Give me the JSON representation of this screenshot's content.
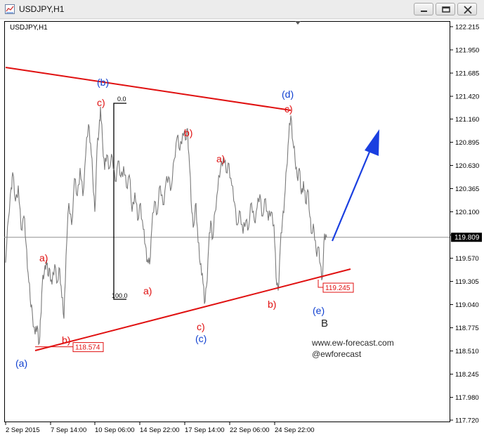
{
  "window": {
    "title": "USDJPY,H1",
    "icon": "chart-window-icon",
    "controls": [
      "minimize-icon",
      "restore-icon",
      "close-icon"
    ]
  },
  "colors": {
    "price": "#7a7a7a",
    "trendline": "#e01010",
    "wave_red": "#e01010",
    "wave_blue": "#1040d0",
    "arrow": "#1a3fe0",
    "bid_line": "#909090",
    "background": "#ffffff"
  },
  "chart_data": {
    "type": "line",
    "symbol_label": "USDJPY,H1",
    "x_ticks": [
      "2 Sep 2015",
      "7 Sep 14:00",
      "10 Sep 06:00",
      "14 Sep 22:00",
      "17 Sep 14:00",
      "22 Sep 06:00",
      "24 Sep 22:00"
    ],
    "y_ticks": [
      "122.215",
      "121.950",
      "121.685",
      "121.420",
      "121.160",
      "120.895",
      "120.630",
      "120.365",
      "120.100",
      "119.835",
      "119.570",
      "119.305",
      "119.040",
      "118.775",
      "118.510",
      "118.245",
      "117.980",
      "117.720"
    ],
    "ylim": [
      117.72,
      122.215
    ],
    "xlim": [
      0,
      660
    ],
    "current_price": "119.809",
    "price_labels": [
      "118.574",
      "119.245"
    ],
    "fib_labels": [
      "0.0",
      "100.0"
    ],
    "series": [
      {
        "values": [
          [
            0,
            119.52
          ],
          [
            4,
            120.02
          ],
          [
            8,
            120.38
          ],
          [
            10,
            120.55
          ],
          [
            14,
            120.22
          ],
          [
            18,
            120.4
          ],
          [
            22,
            119.9
          ],
          [
            26,
            120.05
          ],
          [
            29,
            119.74
          ],
          [
            32,
            119.4
          ],
          [
            35,
            119.1
          ],
          [
            38,
            118.95
          ],
          [
            42,
            118.7
          ],
          [
            45,
            118.8
          ],
          [
            48,
            118.6
          ],
          [
            50,
            118.9
          ],
          [
            52,
            119.25
          ],
          [
            55,
            119.4
          ],
          [
            58,
            119.55
          ],
          [
            60,
            119.38
          ],
          [
            63,
            119.44
          ],
          [
            66,
            119.27
          ],
          [
            70,
            119.5
          ],
          [
            74,
            119.3
          ],
          [
            77,
            119.45
          ],
          [
            80,
            119.12
          ],
          [
            83,
            118.88
          ],
          [
            86,
            119.6
          ],
          [
            90,
            120.2
          ],
          [
            94,
            119.95
          ],
          [
            98,
            120.48
          ],
          [
            102,
            120.28
          ],
          [
            106,
            120.6
          ],
          [
            110,
            120.28
          ],
          [
            114,
            120.75
          ],
          [
            118,
            121.1
          ],
          [
            121,
            120.88
          ],
          [
            124,
            120.5
          ],
          [
            127,
            120.1
          ],
          [
            130,
            120.8
          ],
          [
            133,
            121.05
          ],
          [
            135,
            121.3
          ],
          [
            138,
            120.9
          ],
          [
            141,
            120.58
          ],
          [
            144,
            120.75
          ],
          [
            148,
            120.6
          ],
          [
            152,
            120.72
          ],
          [
            156,
            120.45
          ],
          [
            160,
            120.68
          ],
          [
            164,
            120.5
          ],
          [
            168,
            120.62
          ],
          [
            172,
            120.38
          ],
          [
            176,
            120.52
          ],
          [
            180,
            120.1
          ],
          [
            184,
            120.32
          ],
          [
            188,
            120.0
          ],
          [
            192,
            120.2
          ],
          [
            196,
            119.9
          ],
          [
            199,
            119.72
          ],
          [
            202,
            119.55
          ],
          [
            205,
            119.5
          ],
          [
            208,
            119.9
          ],
          [
            212,
            120.22
          ],
          [
            216,
            120.08
          ],
          [
            220,
            120.4
          ],
          [
            224,
            120.18
          ],
          [
            228,
            120.42
          ],
          [
            232,
            120.5
          ],
          [
            236,
            120.38
          ],
          [
            240,
            120.7
          ],
          [
            244,
            120.95
          ],
          [
            248,
            120.8
          ],
          [
            252,
            121.0
          ],
          [
            256,
            120.92
          ],
          [
            259,
            121.05
          ],
          [
            262,
            120.6
          ],
          [
            265,
            120.1
          ],
          [
            268,
            119.95
          ],
          [
            271,
            120.2
          ],
          [
            274,
            119.75
          ],
          [
            277,
            119.5
          ],
          [
            280,
            119.4
          ],
          [
            283,
            119.05
          ],
          [
            286,
            119.25
          ],
          [
            289,
            119.7
          ],
          [
            292,
            120.0
          ],
          [
            295,
            119.8
          ],
          [
            298,
            120.1
          ],
          [
            302,
            120.35
          ],
          [
            306,
            120.6
          ],
          [
            310,
            120.72
          ],
          [
            314,
            120.55
          ],
          [
            318,
            120.65
          ],
          [
            322,
            120.4
          ],
          [
            326,
            120.2
          ],
          [
            330,
            119.95
          ],
          [
            334,
            120.1
          ],
          [
            338,
            119.85
          ],
          [
            342,
            120.0
          ],
          [
            346,
            119.92
          ],
          [
            350,
            120.2
          ],
          [
            354,
            120.0
          ],
          [
            358,
            120.15
          ],
          [
            362,
            120.3
          ],
          [
            366,
            120.05
          ],
          [
            370,
            120.25
          ],
          [
            374,
            120.0
          ],
          [
            378,
            120.1
          ],
          [
            382,
            119.95
          ],
          [
            385,
            119.35
          ],
          [
            388,
            119.2
          ],
          [
            391,
            119.7
          ],
          [
            394,
            120.0
          ],
          [
            397,
            120.25
          ],
          [
            400,
            120.6
          ],
          [
            403,
            120.95
          ],
          [
            406,
            121.2
          ],
          [
            409,
            120.9
          ],
          [
            412,
            120.7
          ],
          [
            415,
            120.5
          ],
          [
            418,
            120.6
          ],
          [
            421,
            120.3
          ],
          [
            424,
            120.45
          ],
          [
            427,
            120.2
          ],
          [
            430,
            120.35
          ],
          [
            433,
            120.05
          ],
          [
            436,
            119.85
          ],
          [
            439,
            119.9
          ],
          [
            442,
            119.65
          ],
          [
            445,
            119.7
          ],
          [
            448,
            119.5
          ],
          [
            451,
            119.35
          ],
          [
            454,
            119.85
          ],
          [
            457,
            119.81
          ]
        ]
      }
    ],
    "annotations": [
      {
        "text": "(b)",
        "color": "blue"
      },
      {
        "text": "c)",
        "color": "red"
      },
      {
        "text": "(d)",
        "color": "blue"
      },
      {
        "text": "c)",
        "color": "red"
      },
      {
        "text": "b)",
        "color": "red"
      },
      {
        "text": "a)",
        "color": "red"
      },
      {
        "text": "a)",
        "color": "red"
      },
      {
        "text": "a)",
        "color": "red"
      },
      {
        "text": "b)",
        "color": "red"
      },
      {
        "text": "(a)",
        "color": "blue"
      },
      {
        "text": "c)",
        "color": "red"
      },
      {
        "text": "(c)",
        "color": "blue"
      },
      {
        "text": "b)",
        "color": "red"
      },
      {
        "text": "(e)",
        "color": "blue"
      },
      {
        "text": "B",
        "color": "black"
      }
    ],
    "grid": false,
    "trendlines": [
      "upper",
      "lower"
    ]
  },
  "watermark": {
    "site": "www.ew-forecast.com",
    "handle": "@ewforecast"
  }
}
